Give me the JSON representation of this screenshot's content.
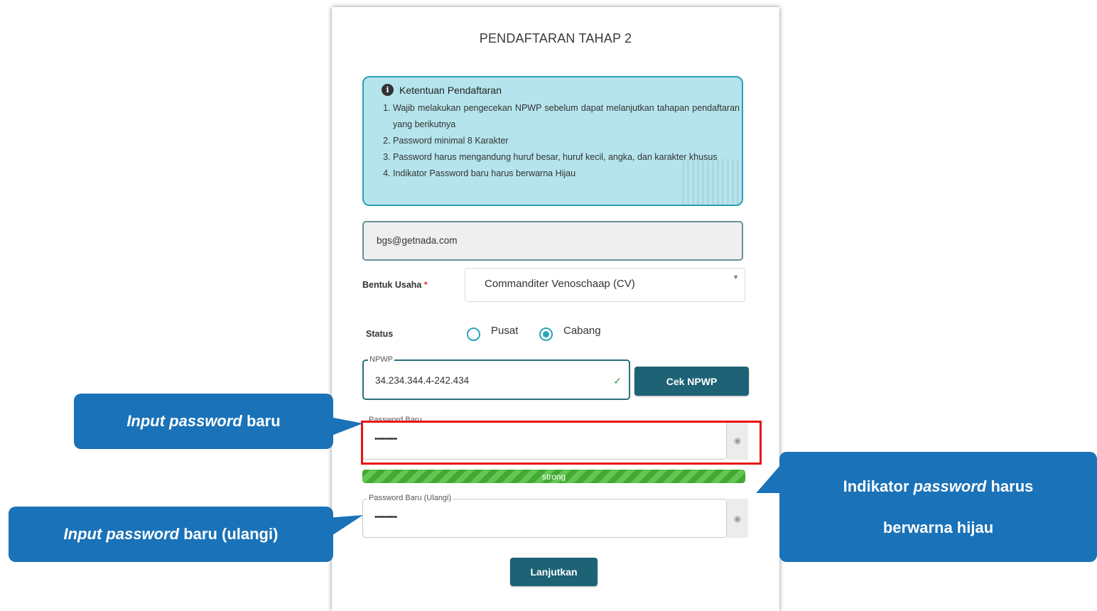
{
  "form": {
    "title": "PENDAFTARAN TAHAP 2",
    "info": {
      "heading": "Ketentuan Pendaftaran",
      "items": [
        "Wajib melakukan pengecekan NPWP sebelum dapat melanjutkan tahapan pendaftaran yang berikutnya",
        "Password minimal 8 Karakter",
        "Password harus mengandung huruf besar, huruf kecil, angka, dan karakter khusus",
        "Indikator Password baru harus berwarna Hijau"
      ]
    },
    "email_value": "bgs@getnada.com",
    "bentuk_usaha": {
      "label": "Bentuk Usaha",
      "required_mark": "*",
      "selected": "Commanditer Venoschaap (CV)"
    },
    "status": {
      "label": "Status",
      "options": [
        "Pusat",
        "Cabang"
      ],
      "selected": "Cabang"
    },
    "npwp": {
      "legend": "NPWP",
      "value": "34.234.344.4-242.434",
      "button": "Cek NPWP"
    },
    "password": {
      "legend": "Password Baru",
      "value": "•••••••••••"
    },
    "strength": {
      "label": "strong",
      "level": 1.0,
      "color": "#44a834"
    },
    "password_repeat": {
      "legend": "Password Baru (Ulangi)",
      "value": "•••••••••••"
    },
    "submit": "Lanjutkan"
  },
  "callouts": {
    "left1": {
      "italic": "Input password",
      "normal": " baru"
    },
    "left2": {
      "italic": "Input password",
      "normal": " baru (ulangi)"
    },
    "right": {
      "line1_a": "Indikator ",
      "line1_italic": "password",
      "line1_b": " harus",
      "line2": "berwarna hijau"
    }
  },
  "colors": {
    "accent": "#1d6275",
    "callout": "#1a72b8",
    "highlight": "#e81313"
  }
}
